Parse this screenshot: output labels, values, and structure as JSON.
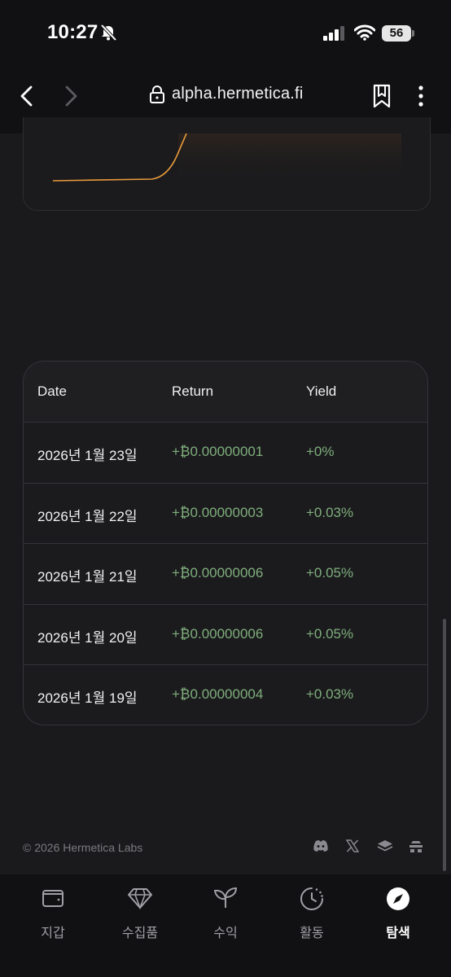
{
  "status_bar": {
    "time": "10:27",
    "battery": "56"
  },
  "browser": {
    "url": "alpha.hermetica.fi"
  },
  "table": {
    "headers": {
      "date": "Date",
      "return": "Return",
      "yield": "Yield"
    },
    "rows": [
      {
        "date": "2026년 1월 23일",
        "return": "+₿0.00000001",
        "yield": "+0%"
      },
      {
        "date": "2026년 1월 22일",
        "return": "+₿0.00000003",
        "yield": "+0.03%"
      },
      {
        "date": "2026년 1월 21일",
        "return": "+₿0.00000006",
        "yield": "+0.05%"
      },
      {
        "date": "2026년 1월 20일",
        "return": "+₿0.00000006",
        "yield": "+0.05%"
      },
      {
        "date": "2026년 1월 19일",
        "return": "+₿0.00000004",
        "yield": "+0.03%"
      }
    ]
  },
  "footer": {
    "copyright": "© 2026 Hermetica Labs",
    "social_icons": [
      "discord-icon",
      "x-icon",
      "docs-layers-icon",
      "hive-icon"
    ]
  },
  "tabbar": {
    "tabs": [
      {
        "label": "지갑",
        "icon": "wallet-icon",
        "active": false
      },
      {
        "label": "수집품",
        "icon": "diamond-icon",
        "active": false
      },
      {
        "label": "수익",
        "icon": "sprout-icon",
        "active": false
      },
      {
        "label": "활동",
        "icon": "history-clock-icon",
        "active": false
      },
      {
        "label": "탐색",
        "icon": "compass-icon",
        "active": true
      }
    ]
  },
  "colors": {
    "background": "#1a1a1c",
    "positive": "#7fae7b",
    "chart_line": "#e89a3c",
    "border": "#34343a"
  }
}
